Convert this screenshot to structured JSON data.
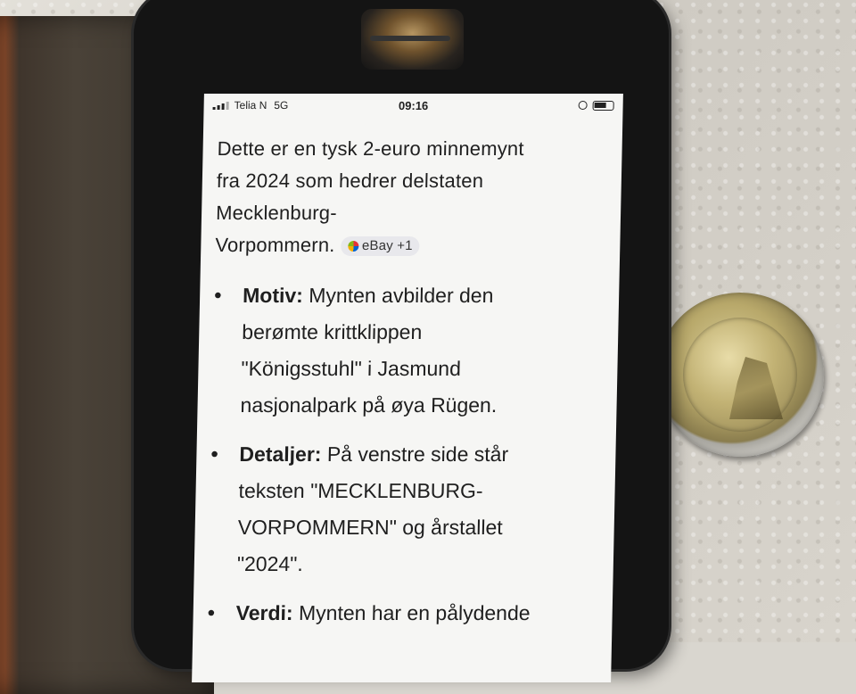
{
  "status_bar": {
    "carrier": "Telia N",
    "network": "5G",
    "time": "09:16"
  },
  "intro": {
    "line1": "Dette er en tysk 2-euro minnemynt",
    "line2": "fra 2024 som hedrer delstaten",
    "line3": "Mecklenburg-",
    "line4": "Vorpommern.",
    "source_chip": "eBay +1"
  },
  "points": [
    {
      "label": "Motiv:",
      "text1": " Mynten avbilder den",
      "text2": "berømte krittklippen",
      "text3": "\"Königsstuhl\" i Jasmund",
      "text4": "nasjonalpark på øya Rügen."
    },
    {
      "label": "Detaljer:",
      "text1": " På venstre side står",
      "text2": "teksten \"MECKLENBURG-",
      "text3": "VORPOMMERN\" og årstallet",
      "text4": "\"2024\"."
    },
    {
      "label": "Verdi:",
      "text1": " Mynten har en pålydende"
    }
  ],
  "colors": {
    "screen_bg": "#f6f6f4",
    "text": "#1f1f1f",
    "chip_bg": "#e8e8ec"
  }
}
